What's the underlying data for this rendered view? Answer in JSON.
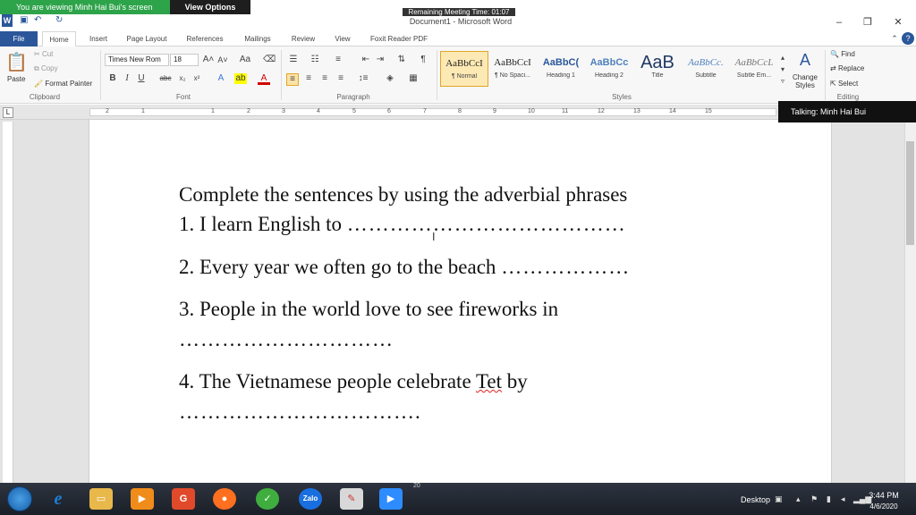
{
  "zoom": {
    "viewing_banner": "You are viewing Minh Hai Bui's screen",
    "view_options": "View Options",
    "remaining": "Remaining Meeting Time: 01:07",
    "talking": "Talking: Minh Hai Bui"
  },
  "window": {
    "title": "Document1 - Microsoft Word"
  },
  "tabs": [
    "File",
    "Home",
    "Insert",
    "Page Layout",
    "References",
    "Mailings",
    "Review",
    "View",
    "Foxit Reader PDF"
  ],
  "ribbon": {
    "clipboard": {
      "paste": "Paste",
      "cut": "Cut",
      "copy": "Copy",
      "format_painter": "Format Painter",
      "label": "Clipboard"
    },
    "font": {
      "name": "Times New Rom",
      "size": "18",
      "label": "Font"
    },
    "paragraph": {
      "label": "Paragraph"
    },
    "styles": {
      "items": [
        {
          "sample": "AaBbCcI",
          "name": "¶ Normal"
        },
        {
          "sample": "AaBbCcI",
          "name": "¶ No Spaci..."
        },
        {
          "sample": "AaBbC(",
          "name": "Heading 1"
        },
        {
          "sample": "AaBbCc",
          "name": "Heading 2"
        },
        {
          "sample": "AaB",
          "name": "Title"
        },
        {
          "sample": "AaBbCc.",
          "name": "Subtitle"
        },
        {
          "sample": "AaBbCcL",
          "name": "Subtle Em..."
        }
      ],
      "change_styles": "Change Styles",
      "label": "Styles"
    },
    "editing": {
      "find": "Find",
      "replace": "Replace",
      "select": "Select",
      "label": "Editing"
    }
  },
  "ruler": {
    "numbers": [
      "2",
      "1",
      "1",
      "2",
      "3",
      "4",
      "5",
      "6",
      "7",
      "8",
      "9",
      "10",
      "11",
      "12",
      "13",
      "14",
      "15"
    ]
  },
  "document": {
    "heading": "Complete the sentences by using the adverbial phrases",
    "s1": "1. I learn English to ",
    "s1_dots": "…………………………………",
    "s2": "2. Every year we often go to the beach ",
    "s2_dots": "………………",
    "s3": "3. People in the world love to see fireworks in",
    "s3_dots": "…………………………",
    "s4_a": "4. The Vietnamese people celebrate ",
    "s4_tet": "Tet",
    "s4_b": " by",
    "s4_dots": "…………………………….",
    "accent": "#2b579a"
  },
  "taskbar": {
    "desktop": "Desktop",
    "time": "3:44 PM",
    "date": "4/6/2020",
    "zalo": "Zalo",
    "count": "20"
  }
}
